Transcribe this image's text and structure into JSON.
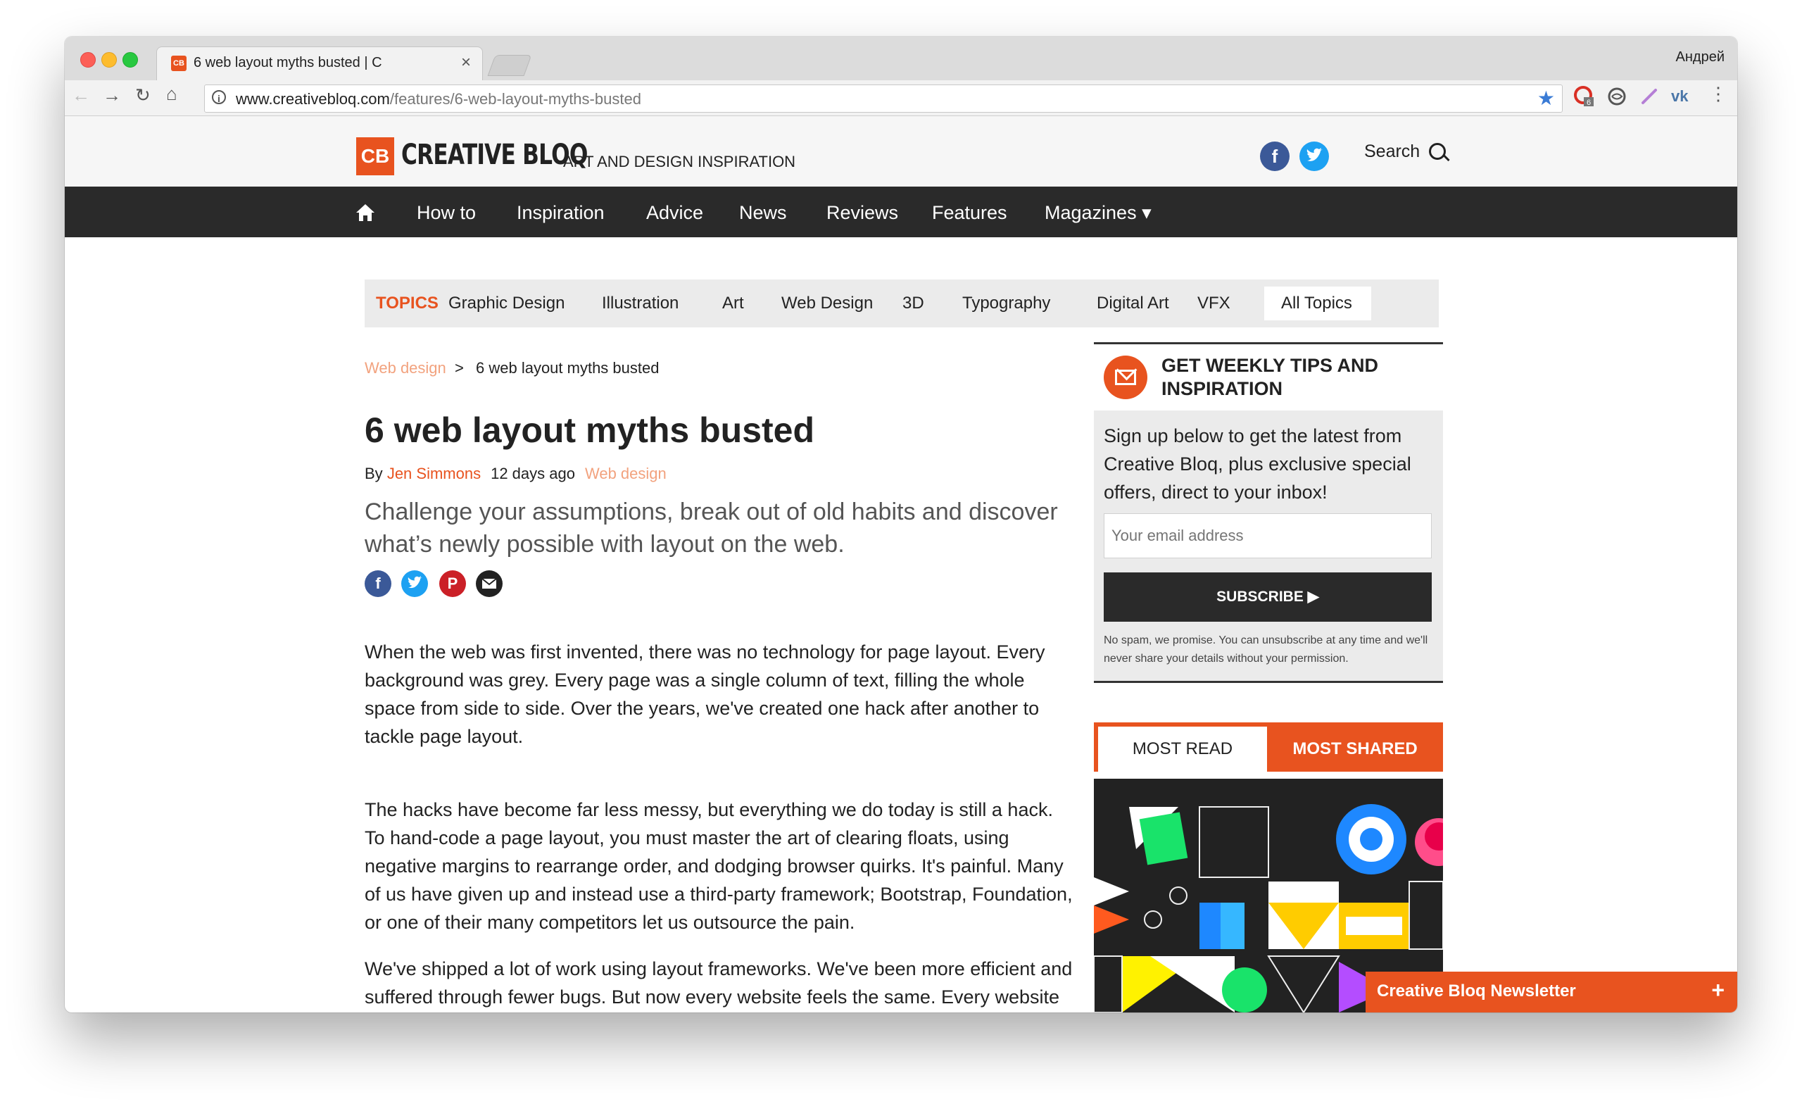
{
  "browser": {
    "tab_title": "6 web layout myths busted | C",
    "tab_favicon": "CB",
    "profile_name": "Андрей",
    "url_domain": "www.creativebloq.com",
    "url_path": "/features/6-web-layout-myths-busted",
    "extension_badge": "6"
  },
  "site": {
    "logo_mark": "CB",
    "logo_text": "CREATIVE BLOQ",
    "tagline": "ART AND DESIGN INSPIRATION",
    "search_label": "Search",
    "brand_color": "#e8531f"
  },
  "nav": {
    "items": [
      "How to",
      "Inspiration",
      "Advice",
      "News",
      "Reviews",
      "Features",
      "Magazines ▾"
    ]
  },
  "topics": {
    "label": "TOPICS",
    "items": [
      "Graphic Design",
      "Illustration",
      "Art",
      "Web Design",
      "3D",
      "Typography",
      "Digital Art",
      "VFX"
    ],
    "all": "All Topics"
  },
  "article": {
    "breadcrumb_link": "Web design",
    "breadcrumb_sep": ">",
    "breadcrumb_current": "6 web layout myths busted",
    "title": "6 web layout myths busted",
    "by": "By",
    "author": "Jen Simmons",
    "date": "12 days ago",
    "category": "Web design",
    "standfirst": "Challenge your assumptions, break out of old habits and discover what’s newly possible with layout on the web.",
    "paragraphs": [
      "When the web was first invented, there was no technology for page layout. Every background was grey. Every page was a single column of text, filling the whole space from side to side. Over the years, we've created one hack after another to tackle page layout.",
      "The hacks have become far less messy, but everything we do today is still a hack. To hand-code a page layout, you must master the art of clearing floats, using negative margins to rearrange order, and dodging browser quirks. It's painful. Many of us have given up and instead use a third-party framework; Bootstrap, Foundation, or one of their many competitors let us outsource the pain.",
      "We've shipped a lot of work using layout frameworks. We've been more efficient and suffered through fewer bugs. But now every website feels the same. Every website reaches for an identical 12-column symmetrical grid. Every site uses the"
    ]
  },
  "sidebar": {
    "newsletter_heading": "GET WEEKLY TIPS AND INSPIRATION",
    "newsletter_text": "Sign up below to get the latest from Creative Bloq, plus exclusive special offers, direct to your inbox!",
    "email_placeholder": "Your email address",
    "subscribe_label": "SUBSCRIBE ▶",
    "fine_print": "No spam, we promise. You can unsubscribe at any time and we'll never share your details without your permission.",
    "most_read": "MOST READ",
    "most_shared": "MOST SHARED"
  },
  "floating": {
    "newsletter_label": "Creative Bloq Newsletter",
    "plus": "+"
  }
}
